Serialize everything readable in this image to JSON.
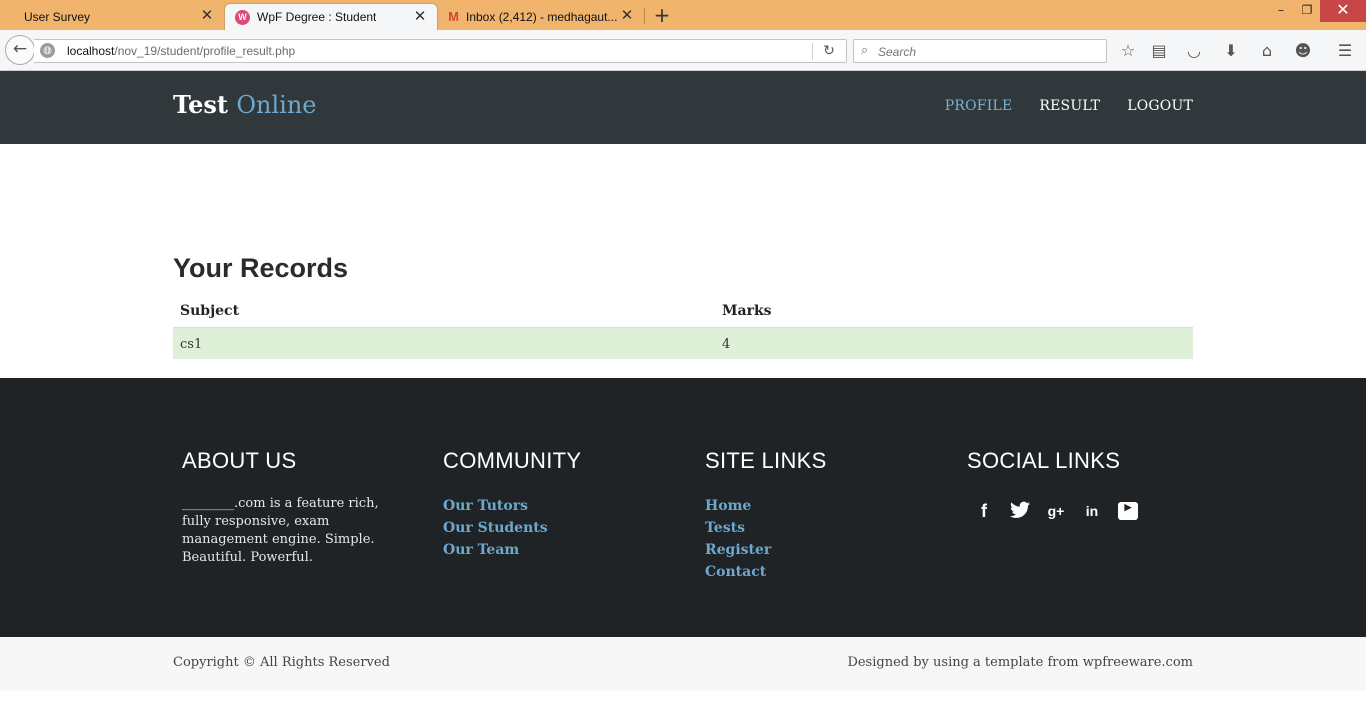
{
  "browser": {
    "tabs": [
      {
        "title": "User Survey",
        "active": false
      },
      {
        "title": "WpF Degree : Student",
        "active": true
      },
      {
        "title": "Inbox (2,412) - medhagaut...",
        "active": false
      }
    ],
    "url_host": "localhost",
    "url_path": "/nov_19/student/profile_result.php",
    "search_placeholder": "Search",
    "icons": [
      "back-icon",
      "globe-icon",
      "reload-icon",
      "search-icon",
      "bookmark-star-icon",
      "reading-list-icon",
      "pocket-icon",
      "download-icon",
      "home-icon",
      "chat-icon",
      "menu-icon"
    ]
  },
  "site": {
    "brand_first": "Test",
    "brand_second": "Online",
    "nav": {
      "profile": "PROFILE",
      "result": "RESULT",
      "logout": "LOGOUT"
    },
    "accent_color": "#6da9cf",
    "header_color": "#31383b"
  },
  "records": {
    "title": "Your Records",
    "columns": [
      "Subject",
      "Marks"
    ],
    "rows": [
      {
        "subject": "cs1",
        "marks": "4"
      }
    ],
    "row_color": "#dff0d8"
  },
  "footer": {
    "about": {
      "heading": "ABOUT US",
      "text": "________.com is a feature rich, fully responsive, exam management engine. Simple. Beautiful. Powerful."
    },
    "community": {
      "heading": "COMMUNITY",
      "links": [
        "Our Tutors",
        "Our Students",
        "Our Team"
      ]
    },
    "site_links": {
      "heading": "SITE LINKS",
      "links": [
        "Home",
        "Tests",
        "Register",
        "Contact"
      ]
    },
    "social": {
      "heading": "SOCIAL LINKS",
      "icons": [
        "facebook-icon",
        "twitter-icon",
        "google-plus-icon",
        "linkedin-icon",
        "youtube-icon"
      ]
    },
    "copyright": "Copyright © All Rights Reserved",
    "designed_by": "Designed by using a template from wpfreeware.com"
  }
}
